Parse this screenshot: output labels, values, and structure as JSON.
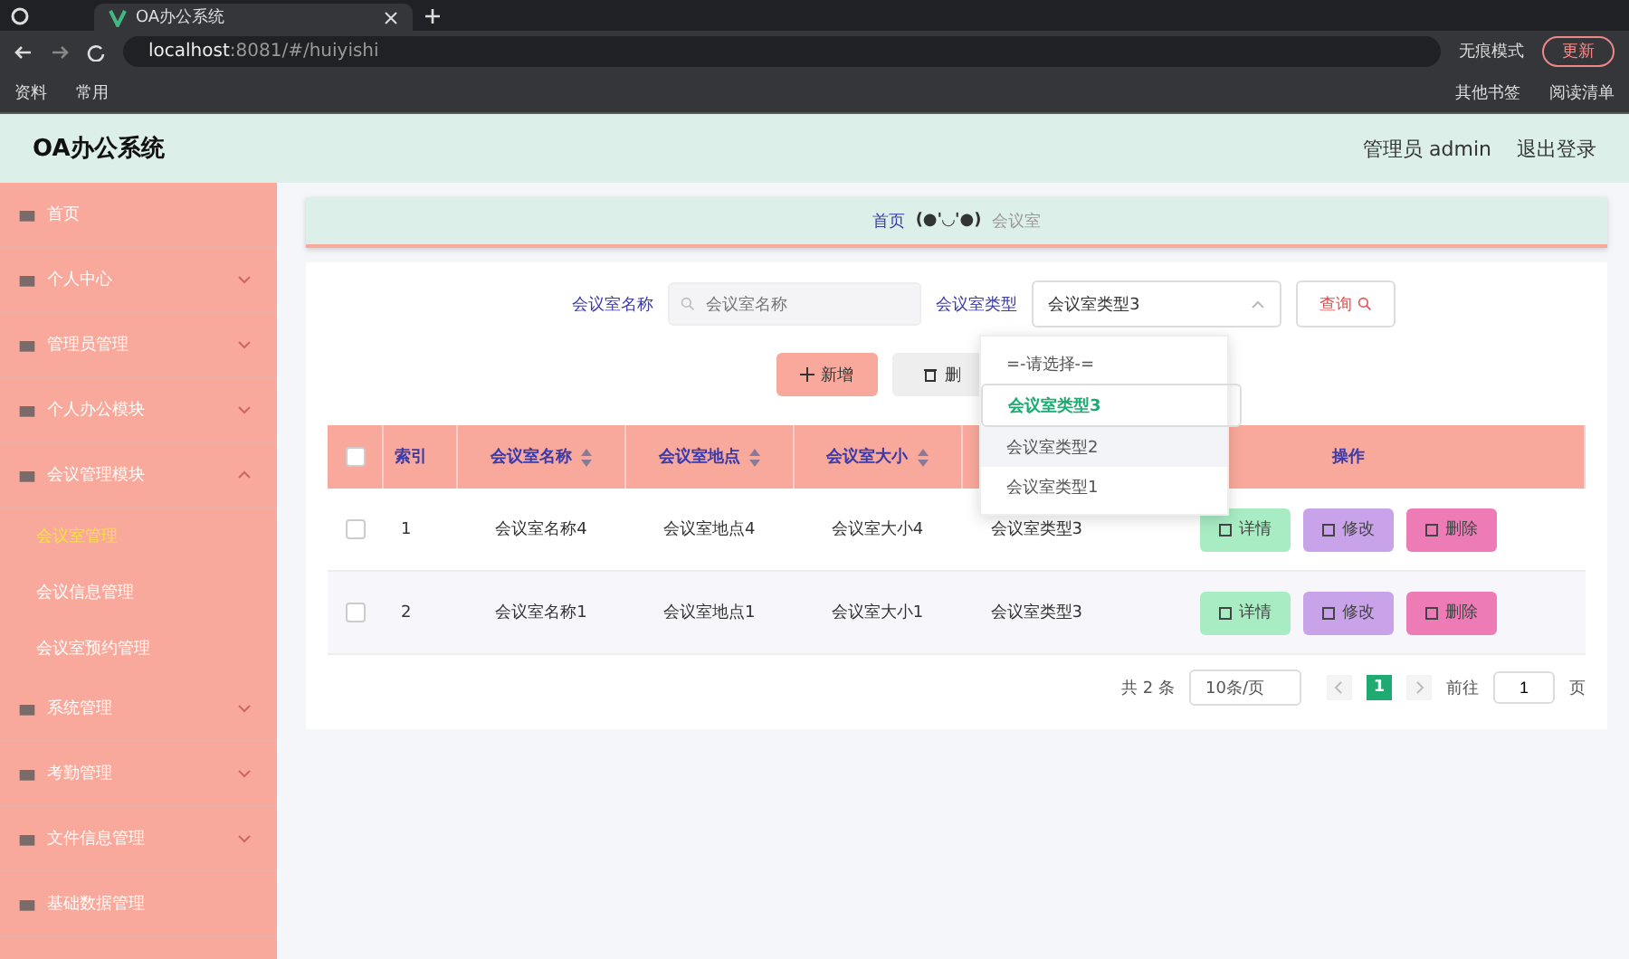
{
  "browser": {
    "tab_title": "OA办公系统",
    "url_host": "localhost",
    "url_rest": ":8081/#/huiyishi",
    "incognito": "无痕模式",
    "update": "更新",
    "bookmarks": [
      "资料",
      "常用"
    ],
    "bookmarks_right": [
      "其他书签",
      "阅读清单"
    ]
  },
  "header": {
    "title": "OA办公系统",
    "user": "管理员 admin",
    "logout": "退出登录"
  },
  "sidebar": {
    "items": [
      {
        "label": "首页"
      },
      {
        "label": "个人中心",
        "expanded": false
      },
      {
        "label": "管理员管理",
        "expanded": false
      },
      {
        "label": "个人办公模块",
        "expanded": false
      },
      {
        "label": "会议管理模块",
        "expanded": true,
        "children": [
          {
            "label": "会议室管理",
            "selected": true
          },
          {
            "label": "会议信息管理",
            "selected": false
          },
          {
            "label": "会议室预约管理",
            "selected": false
          }
        ]
      },
      {
        "label": "系统管理",
        "expanded": false
      },
      {
        "label": "考勤管理",
        "expanded": false
      },
      {
        "label": "文件信息管理",
        "expanded": false
      },
      {
        "label": "基础数据管理"
      }
    ]
  },
  "breadcrumb": {
    "home": "首页",
    "separator": "(●'◡'●)",
    "current": "会议室"
  },
  "search": {
    "name_label": "会议室名称",
    "name_placeholder": "会议室名称",
    "type_label": "会议室类型",
    "type_value": "会议室类型3",
    "query": "查询"
  },
  "actions": {
    "add": "新增",
    "delete": "删"
  },
  "dropdown": {
    "options": [
      {
        "label": "=-请选择-=",
        "selected": false,
        "hovered": false
      },
      {
        "label": "会议室类型3",
        "selected": true,
        "hovered": false
      },
      {
        "label": "会议室类型2",
        "selected": false,
        "hovered": true
      },
      {
        "label": "会议室类型1",
        "selected": false,
        "hovered": false
      }
    ]
  },
  "table": {
    "select_all_checked": false,
    "columns": [
      {
        "label": "索引",
        "sortable": false
      },
      {
        "label": "会议室名称",
        "sortable": true
      },
      {
        "label": "会议室地点",
        "sortable": true
      },
      {
        "label": "会议室大小",
        "sortable": true
      },
      {
        "sortable": false
      },
      {
        "label": "操作",
        "sortable": false
      }
    ],
    "rows": [
      {
        "checked": false,
        "cells": [
          "1",
          "会议室名称4",
          "会议室地点4",
          "会议室大小4",
          "会议室类型3"
        ],
        "buttons": [
          "详情",
          "修改",
          "删除"
        ]
      },
      {
        "checked": false,
        "cells": [
          "2",
          "会议室名称1",
          "会议室地点1",
          "会议室大小1",
          "会议室类型3"
        ],
        "buttons": [
          "详情",
          "修改",
          "删除"
        ]
      }
    ]
  },
  "pagination": {
    "total": "共 2 条",
    "page_size": "10条/页",
    "pages": [
      {
        "label": "1",
        "selected": true
      }
    ],
    "goto": "前往",
    "goto_value": "1",
    "page_unit": "页"
  }
}
